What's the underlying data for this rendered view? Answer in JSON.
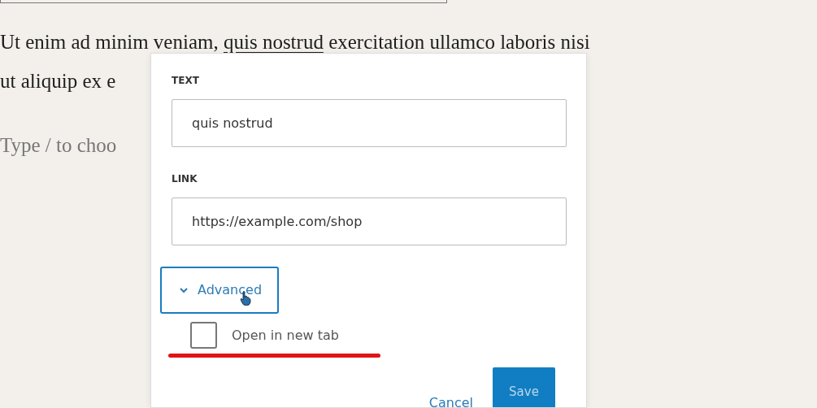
{
  "paragraph": {
    "lines": [
      {
        "before": "Ut enim ad minim veniam, ",
        "link": "quis nostrud",
        "after": " exercitation ullamco laboris nisi"
      },
      {
        "before": "ut aliquip ex e"
      }
    ]
  },
  "block_placeholder": "Type / to choo",
  "link_popover": {
    "fields": [
      {
        "label": "TEXT",
        "value": "quis nostrud"
      },
      {
        "label": "LINK",
        "value": "https://example.com/shop"
      }
    ],
    "advanced": {
      "label": "Advanced",
      "expanded": true,
      "focused": true
    },
    "options": [
      {
        "label": "Open in new tab",
        "checked": false,
        "highlighted": true
      }
    ],
    "buttons": [
      {
        "kind": "link",
        "label": "Cancel"
      },
      {
        "kind": "primary",
        "label": "Save",
        "disabled": true
      }
    ]
  }
}
